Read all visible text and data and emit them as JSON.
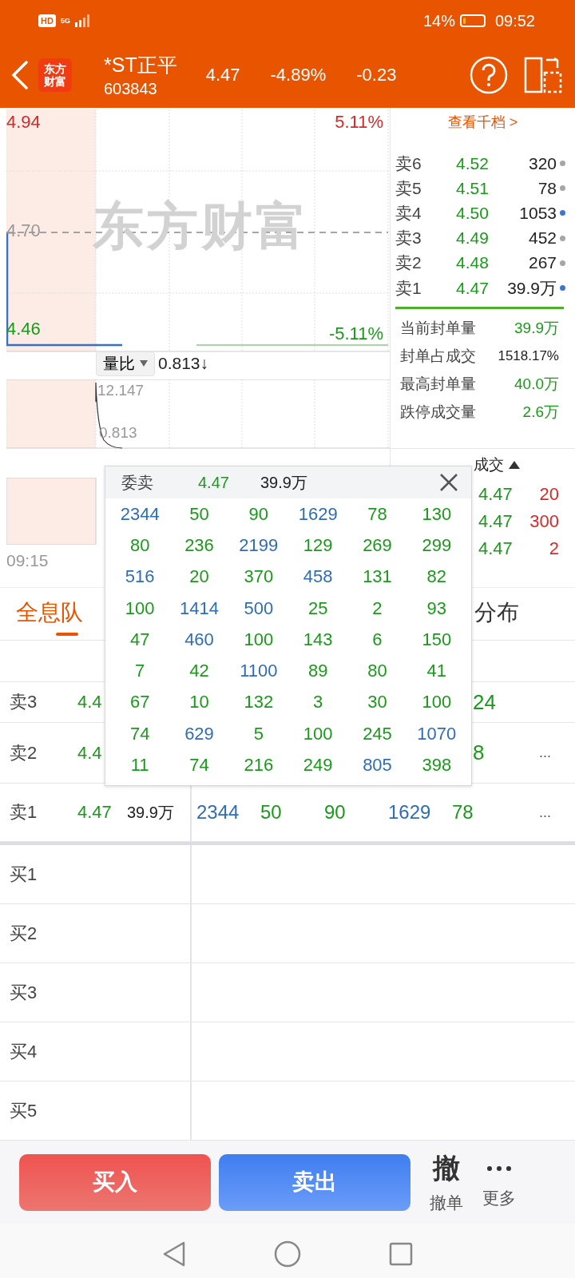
{
  "status_bar": {
    "hd_badge": "HD",
    "network": "5G",
    "battery_text": "14%",
    "battery": {
      "level": 0.14
    },
    "time": "09:52"
  },
  "header": {
    "logo": [
      "东方",
      "财富"
    ],
    "name": "*ST正平",
    "code": "603843",
    "price": "4.47",
    "change_pct": "-4.89%",
    "change": "-0.23"
  },
  "chart": {
    "watermark": "东方财富",
    "price_high": "4.94",
    "pct_high": "5.11%",
    "price_mid": "4.70",
    "price_low": "4.46",
    "pct_low": "-5.11%",
    "indicator": "量比",
    "indicator_value": "0.813↓",
    "sub_high": "12.147",
    "sub_low": "0.813",
    "time_start": "09:15"
  },
  "order_book": {
    "link": "查看千档 >",
    "asks": [
      {
        "label": "卖6",
        "price": "4.52",
        "volume": "320",
        "color": "#a6a6a6"
      },
      {
        "label": "卖5",
        "price": "4.51",
        "volume": "78",
        "color": "#a6a6a6"
      },
      {
        "label": "卖4",
        "price": "4.50",
        "volume": "1053",
        "color": "#3a78d0"
      },
      {
        "label": "卖3",
        "price": "4.49",
        "volume": "452",
        "color": "#a6a6a6"
      },
      {
        "label": "卖2",
        "price": "4.48",
        "volume": "267",
        "color": "#a6a6a6"
      },
      {
        "label": "卖1",
        "price": "4.47",
        "volume": "39.9万",
        "color": "#3a78d0"
      }
    ]
  },
  "seal_stats": [
    {
      "label": "当前封单量",
      "value": "39.9万",
      "kind": "volume"
    },
    {
      "label": "封单占成交",
      "value": "1518.17%",
      "kind": "ratio"
    },
    {
      "label": "最高封单量",
      "value": "40.0万",
      "kind": "volume"
    },
    {
      "label": "跌停成交量",
      "value": "2.6万",
      "kind": "volume"
    }
  ],
  "trades": {
    "title": "成交",
    "rows": [
      {
        "price": "4.47",
        "volume": "20"
      },
      {
        "price": "4.47",
        "volume": "300"
      },
      {
        "price": "4.47",
        "volume": "2"
      }
    ]
  },
  "tabs": [
    {
      "label": "全息队",
      "selected": true
    },
    {
      "label": "分布",
      "selected": false
    }
  ],
  "queue": {
    "asks": [
      {
        "label": "卖3",
        "price": "4.4",
        "tail": "24"
      },
      {
        "label": "卖2",
        "price": "4.4",
        "tail": "8",
        "more": "..."
      },
      {
        "label": "卖1",
        "price": "4.47",
        "volume": "39.9万",
        "orders": [
          {
            "value": "2344",
            "color": "#2f6db5"
          },
          {
            "value": "50",
            "color": "#1a9a1a"
          },
          {
            "value": "90",
            "color": "#1a9a1a"
          },
          {
            "value": "1629",
            "color": "#2f6db5"
          },
          {
            "value": "78",
            "color": "#1a9a1a"
          }
        ],
        "more": "..."
      }
    ],
    "bids": [
      {
        "label": "买1"
      },
      {
        "label": "买2"
      },
      {
        "label": "买3"
      },
      {
        "label": "买4"
      },
      {
        "label": "买5"
      }
    ]
  },
  "popup": {
    "title": "委卖",
    "price": "4.47",
    "volume": "39.9万",
    "cells": [
      {
        "value": "2344",
        "color": "#2f6db5"
      },
      {
        "value": "50",
        "color": "#1a9a1a"
      },
      {
        "value": "90",
        "color": "#1a9a1a"
      },
      {
        "value": "1629",
        "color": "#2f6db5"
      },
      {
        "value": "78",
        "color": "#1a9a1a"
      },
      {
        "value": "130",
        "color": "#1a9a1a"
      },
      {
        "value": "80",
        "color": "#1a9a1a"
      },
      {
        "value": "236",
        "color": "#1a9a1a"
      },
      {
        "value": "2199",
        "color": "#2f6db5"
      },
      {
        "value": "129",
        "color": "#1a9a1a"
      },
      {
        "value": "269",
        "color": "#1a9a1a"
      },
      {
        "value": "299",
        "color": "#1a9a1a"
      },
      {
        "value": "516",
        "color": "#2f6db5"
      },
      {
        "value": "20",
        "color": "#1a9a1a"
      },
      {
        "value": "370",
        "color": "#1a9a1a"
      },
      {
        "value": "458",
        "color": "#2f6db5"
      },
      {
        "value": "131",
        "color": "#1a9a1a"
      },
      {
        "value": "82",
        "color": "#1a9a1a"
      },
      {
        "value": "100",
        "color": "#1a9a1a"
      },
      {
        "value": "1414",
        "color": "#2f6db5"
      },
      {
        "value": "500",
        "color": "#2f6db5"
      },
      {
        "value": "25",
        "color": "#1a9a1a"
      },
      {
        "value": "2",
        "color": "#1a9a1a"
      },
      {
        "value": "93",
        "color": "#1a9a1a"
      },
      {
        "value": "47",
        "color": "#1a9a1a"
      },
      {
        "value": "460",
        "color": "#2f6db5"
      },
      {
        "value": "100",
        "color": "#1a9a1a"
      },
      {
        "value": "143",
        "color": "#1a9a1a"
      },
      {
        "value": "6",
        "color": "#1a9a1a"
      },
      {
        "value": "150",
        "color": "#1a9a1a"
      },
      {
        "value": "7",
        "color": "#1a9a1a"
      },
      {
        "value": "42",
        "color": "#1a9a1a"
      },
      {
        "value": "1100",
        "color": "#2f6db5"
      },
      {
        "value": "89",
        "color": "#1a9a1a"
      },
      {
        "value": "80",
        "color": "#1a9a1a"
      },
      {
        "value": "41",
        "color": "#1a9a1a"
      },
      {
        "value": "67",
        "color": "#1a9a1a"
      },
      {
        "value": "10",
        "color": "#1a9a1a"
      },
      {
        "value": "132",
        "color": "#1a9a1a"
      },
      {
        "value": "3",
        "color": "#1a9a1a"
      },
      {
        "value": "30",
        "color": "#1a9a1a"
      },
      {
        "value": "100",
        "color": "#1a9a1a"
      },
      {
        "value": "74",
        "color": "#1a9a1a"
      },
      {
        "value": "629",
        "color": "#2f6db5"
      },
      {
        "value": "5",
        "color": "#1a9a1a"
      },
      {
        "value": "100",
        "color": "#1a9a1a"
      },
      {
        "value": "245",
        "color": "#1a9a1a"
      },
      {
        "value": "1070",
        "color": "#2f6db5"
      },
      {
        "value": "11",
        "color": "#1a9a1a"
      },
      {
        "value": "74",
        "color": "#1a9a1a"
      },
      {
        "value": "216",
        "color": "#1a9a1a"
      },
      {
        "value": "249",
        "color": "#1a9a1a"
      },
      {
        "value": "805",
        "color": "#2f6db5"
      },
      {
        "value": "398",
        "color": "#1a9a1a"
      }
    ]
  },
  "actions": {
    "buy": "买入",
    "sell": "卖出",
    "cancel_glyph": "撤",
    "cancel": "撤单",
    "more": "更多"
  }
}
